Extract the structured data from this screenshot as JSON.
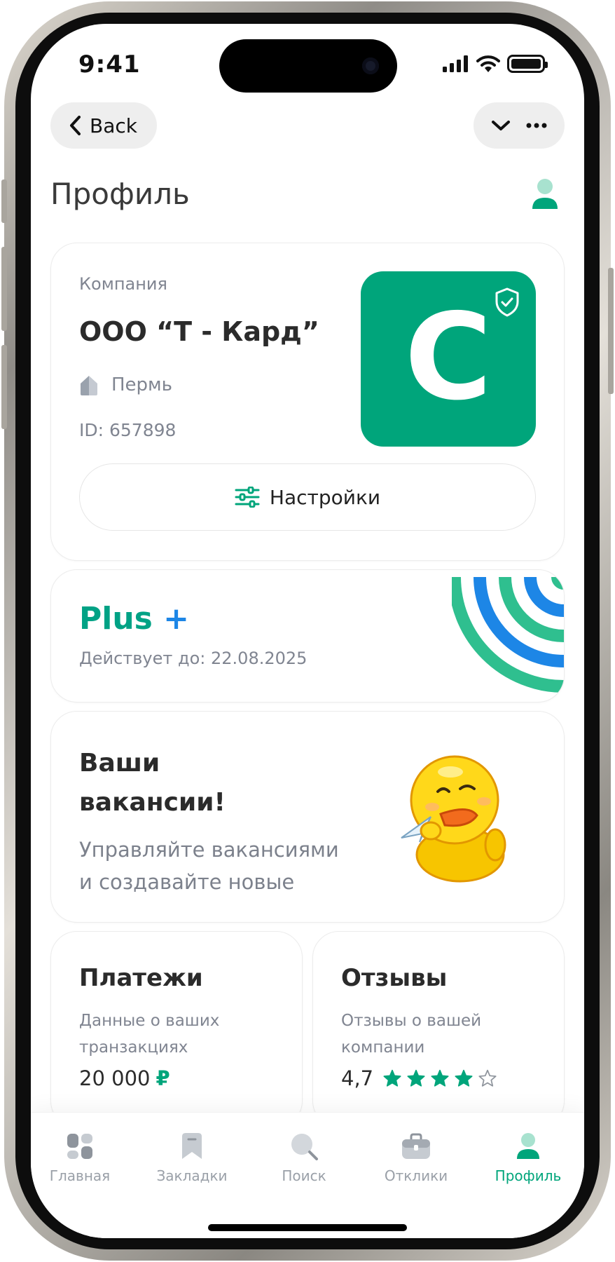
{
  "status_bar": {
    "time": "9:41"
  },
  "nav": {
    "back_label": "Back"
  },
  "page": {
    "title": "Профиль"
  },
  "company": {
    "label": "Компания",
    "name": "ООО “Т - Кард”",
    "city": "Пермь",
    "id": "ID: 657898",
    "logo_letter": "C",
    "brand_color": "#00a57b",
    "settings_label": "Настройки"
  },
  "subscription": {
    "plan_text": "Plus",
    "plan_plus": "+",
    "valid_until": "Действует до: 22.08.2025",
    "colors": [
      "#00a285",
      "#1d86e6"
    ]
  },
  "vacancies": {
    "title_line1": "Ваши",
    "title_line2": "вакансии!",
    "subtitle_line1": "Управляйте вакансиями",
    "subtitle_line2": "и создавайте новые",
    "image": "duck-sticker"
  },
  "payments": {
    "title": "Платежи",
    "subtitle_line1": "Данные о ваших",
    "subtitle_line2": "транзакциях",
    "amount": "20 000",
    "currency": "₽"
  },
  "reviews": {
    "title": "Отзывы",
    "subtitle_line1": "Отзывы о вашей",
    "subtitle_line2": "компании",
    "rating": "4,7",
    "stars_filled": 4,
    "stars_total": 5
  },
  "tabbar": {
    "items": [
      {
        "label": "Главная",
        "icon": "home-icon"
      },
      {
        "label": "Закладки",
        "icon": "bookmark-icon"
      },
      {
        "label": "Поиск",
        "icon": "search-icon"
      },
      {
        "label": "Отклики",
        "icon": "briefcase-icon"
      },
      {
        "label": "Профиль",
        "icon": "profile-icon"
      }
    ],
    "active_index": 4,
    "active_color": "#00a57b"
  }
}
